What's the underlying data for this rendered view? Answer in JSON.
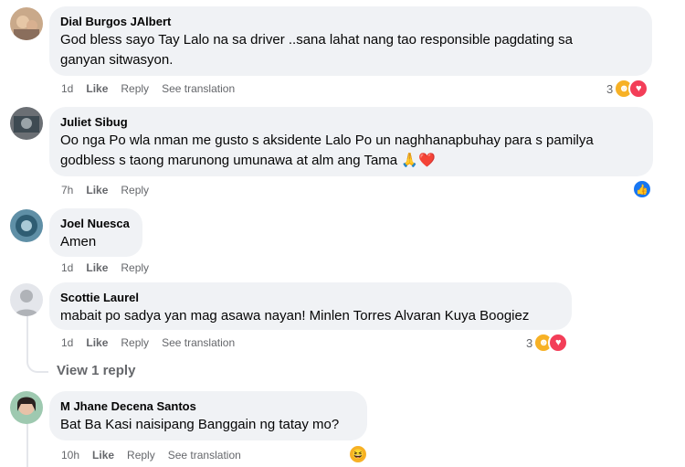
{
  "comments": [
    {
      "author": "Dial Burgos JAlbert",
      "lines": [
        "God bless sayo Tay Lalo na sa driver ..sana lahat nang tao responsible pagdating sa",
        "ganyan sitwasyon."
      ],
      "time": "1d",
      "like": "Like",
      "reply": "Reply",
      "translation": "See translation",
      "reaction_count": "3"
    },
    {
      "author": "Juliet Sibug",
      "lines": [
        "Oo nga Po wla nman me gusto s aksidente Lalo Po un naghhanapbuhay para s pamilya",
        "godbless s taong marunong umunawa at alm ang Tama 🙏❤️"
      ],
      "time": "7h",
      "like": "Like",
      "reply": "Reply"
    },
    {
      "author": "Joel Nuesca",
      "lines": [
        "Amen"
      ],
      "time": "1d",
      "like": "Like",
      "reply": "Reply"
    },
    {
      "author": "Scottie Laurel",
      "lines": [
        "mabait po sadya yan mag asawa nayan! Minlen Torres Alvaran Kuya Boogiez"
      ],
      "time": "1d",
      "like": "Like",
      "reply": "Reply",
      "translation": "See translation",
      "reaction_count": "3",
      "view_replies": "View 1 reply"
    },
    {
      "author": "M Jhane Decena Santos",
      "lines": [
        "Bat Ba Kasi naisipang Banggain ng tatay mo?"
      ],
      "time": "10h",
      "like": "Like",
      "reply": "Reply",
      "translation": "See translation"
    }
  ],
  "colors": {
    "bubble": "#f0f2f5",
    "meta_text": "#65676b",
    "like_blue": "#1877f2",
    "love_red": "#f33e58",
    "care_yellow": "#f7b125"
  },
  "icons": [
    "care-reaction-icon",
    "love-reaction-icon",
    "like-reaction-icon",
    "haha-reaction-icon"
  ]
}
